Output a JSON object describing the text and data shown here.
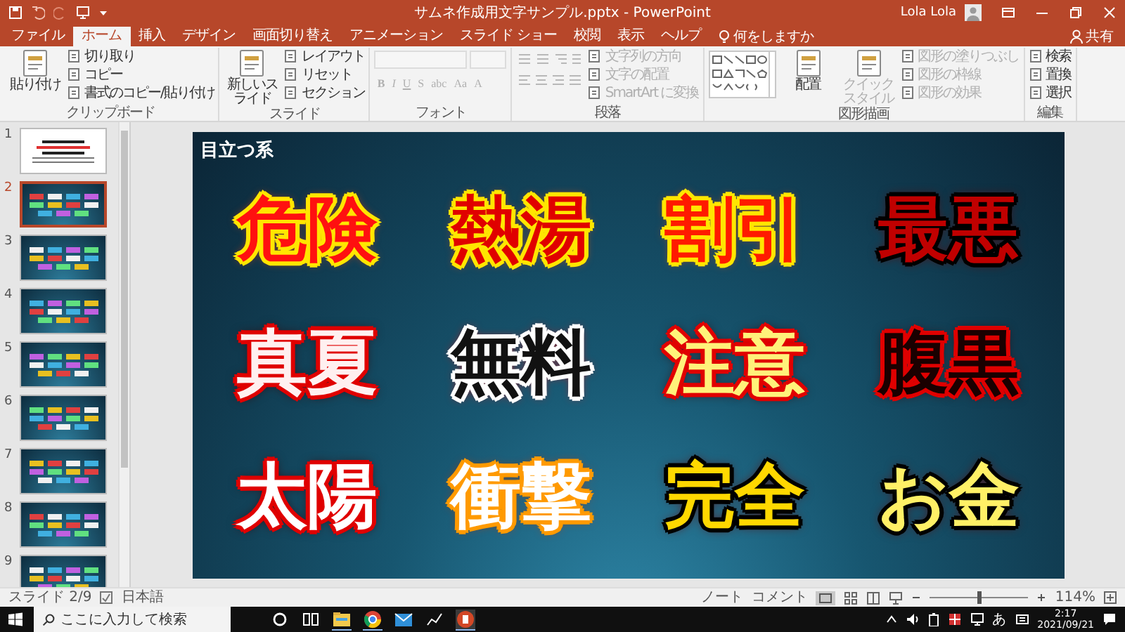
{
  "window": {
    "title": "サムネ作成用文字サンプル.pptx - PowerPoint",
    "user": "Lola Lola"
  },
  "tabs": [
    {
      "label": "ファイル",
      "selected": false
    },
    {
      "label": "ホーム",
      "selected": true
    },
    {
      "label": "挿入",
      "selected": false
    },
    {
      "label": "デザイン",
      "selected": false
    },
    {
      "label": "画面切り替え",
      "selected": false
    },
    {
      "label": "アニメーション",
      "selected": false
    },
    {
      "label": "スライド ショー",
      "selected": false
    },
    {
      "label": "校閲",
      "selected": false
    },
    {
      "label": "表示",
      "selected": false
    },
    {
      "label": "ヘルプ",
      "selected": false
    }
  ],
  "tell_me": "何をしますか",
  "share": "共有",
  "ribbon_groups": [
    {
      "label": "クリップボード",
      "columns": [
        [
          {
            "kind": "large",
            "label": "貼り付け",
            "disabled": false
          }
        ],
        [
          {
            "kind": "small",
            "label": "切り取り",
            "disabled": false
          },
          {
            "kind": "small",
            "label": "コピー",
            "disabled": false
          },
          {
            "kind": "small",
            "label": "書式のコピー/貼り付け",
            "disabled": false
          }
        ]
      ]
    },
    {
      "label": "スライド",
      "columns": [
        [
          {
            "kind": "large",
            "label": "新しいスライド",
            "disabled": false
          }
        ],
        [
          {
            "kind": "small",
            "label": "レイアウト",
            "disabled": false
          },
          {
            "kind": "small",
            "label": "リセット",
            "disabled": false
          },
          {
            "kind": "small",
            "label": "セクション",
            "disabled": false
          }
        ]
      ]
    },
    {
      "label": "フォント",
      "columns": [
        [
          {
            "kind": "combo",
            "disabled": true
          },
          {
            "kind": "format",
            "labels": [
              "B",
              "I",
              "U",
              "S",
              "abc",
              "Aa",
              "A"
            ],
            "disabled": true
          }
        ]
      ]
    },
    {
      "label": "段落",
      "columns": [
        [
          {
            "kind": "lists",
            "disabled": true
          },
          {
            "kind": "align",
            "disabled": true
          }
        ],
        [
          {
            "kind": "small",
            "label": "文字列の方向",
            "disabled": true
          },
          {
            "kind": "small",
            "label": "文字の配置",
            "disabled": true
          },
          {
            "kind": "small",
            "label": "SmartArt に変換",
            "disabled": true
          }
        ]
      ]
    },
    {
      "label": "図形描画",
      "columns": [
        [
          {
            "kind": "shapes",
            "disabled": false
          }
        ],
        [
          {
            "kind": "large",
            "label": "配置",
            "disabled": false
          }
        ],
        [
          {
            "kind": "large",
            "label": "クイックスタイル",
            "disabled": true
          }
        ],
        [
          {
            "kind": "small",
            "label": "図形の塗りつぶし",
            "disabled": true
          },
          {
            "kind": "small",
            "label": "図形の枠線",
            "disabled": true
          },
          {
            "kind": "small",
            "label": "図形の効果",
            "disabled": true
          }
        ]
      ]
    },
    {
      "label": "編集",
      "columns": [
        [
          {
            "kind": "small",
            "label": "検索",
            "disabled": false
          },
          {
            "kind": "small",
            "label": "置換",
            "disabled": false
          },
          {
            "kind": "small",
            "label": "選択",
            "disabled": false
          }
        ]
      ]
    }
  ],
  "thumbnails": [
    {
      "number": "1",
      "kind": "title",
      "selected": false
    },
    {
      "number": "2",
      "kind": "samples",
      "selected": true
    },
    {
      "number": "3",
      "kind": "samples",
      "selected": false
    },
    {
      "number": "4",
      "kind": "samples",
      "selected": false
    },
    {
      "number": "5",
      "kind": "samples",
      "selected": false
    },
    {
      "number": "6",
      "kind": "samples",
      "selected": false
    },
    {
      "number": "7",
      "kind": "samples",
      "selected": false
    },
    {
      "number": "8",
      "kind": "samples",
      "selected": false
    },
    {
      "number": "9",
      "kind": "samples",
      "selected": false
    }
  ],
  "slide": {
    "title": "目立つ系",
    "words": [
      {
        "text": "危険",
        "color": "#ff1010",
        "kind": "yellowrim"
      },
      {
        "text": "熱湯",
        "color": "#e00000",
        "kind": "yellowrim"
      },
      {
        "text": "割引",
        "color": "#ff1a00",
        "kind": "yellowrim"
      },
      {
        "text": "最悪",
        "color": "#c00000",
        "kind": "blackrim"
      },
      {
        "text": "真夏",
        "color": "#fff0f0",
        "kind": "redrim"
      },
      {
        "text": "無料",
        "color": "#111111",
        "kind": "whiterim"
      },
      {
        "text": "注意",
        "color": "#fff27a",
        "kind": "redrim"
      },
      {
        "text": "腹黒",
        "color": "#1a0000",
        "kind": "redrim"
      },
      {
        "text": "太陽",
        "color": "#ffffff",
        "kind": "redrim"
      },
      {
        "text": "衝撃",
        "color": "#ffffff",
        "kind": "orangerim"
      },
      {
        "text": "完全",
        "color": "#ffd800",
        "kind": "blackrim"
      },
      {
        "text": "お金",
        "color": "#fff066",
        "kind": "blackrim"
      }
    ]
  },
  "status_bar": {
    "slide": "スライド 2/9",
    "language": "日本語",
    "notes": "ノート",
    "comments": "コメント",
    "zoom_slider": {
      "level": 0.5
    },
    "zoom": "114%"
  },
  "taskbar": {
    "search_placeholder": "ここに入力して検索",
    "ime": "あ",
    "time": "2:17",
    "date": "2021/09/21"
  }
}
